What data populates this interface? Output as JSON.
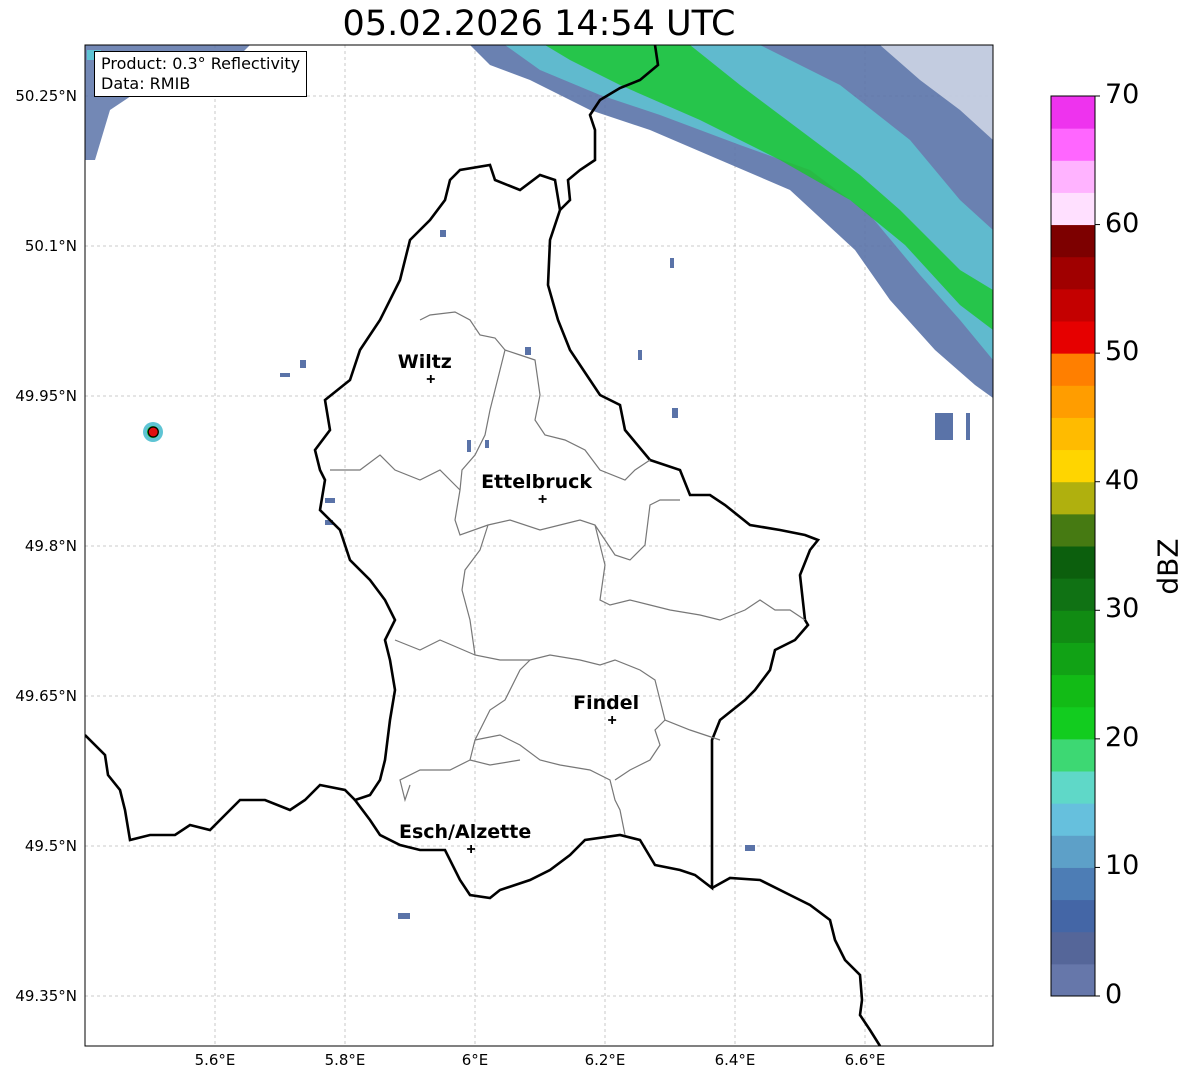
{
  "title": "05.02.2026 14:54 UTC",
  "info": {
    "product": "Product: 0.3° Reflectivity",
    "data": "Data: RMIB"
  },
  "lat_ticks": [
    "50.25°N",
    "50.1°N",
    "49.95°N",
    "49.8°N",
    "49.65°N",
    "49.5°N",
    "49.35°N"
  ],
  "lon_ticks": [
    "5.6°E",
    "5.8°E",
    "6°E",
    "6.2°E",
    "6.4°E",
    "6.6°E"
  ],
  "cities": [
    {
      "name": "Wiltz",
      "lat": 49.967,
      "lon": 5.932
    },
    {
      "name": "Ettelbruck",
      "lat": 49.847,
      "lon": 6.104
    },
    {
      "name": "Findel",
      "lat": 49.626,
      "lon": 6.211
    },
    {
      "name": "Esch/Alzette",
      "lat": 49.497,
      "lon": 5.994
    }
  ],
  "radar_site": {
    "lat": 49.914,
    "lon": 5.505
  },
  "colorbar": {
    "label": "dBZ",
    "ticks": [
      "0",
      "10",
      "20",
      "30",
      "40",
      "50",
      "60",
      "70"
    ],
    "colors": [
      "#6677aa",
      "#556699",
      "#4466a6",
      "#4d7db5",
      "#5da0c8",
      "#66c0dd",
      "#5fd8c8",
      "#3dd873",
      "#12cc1f",
      "#12bb16",
      "#11a215",
      "#118b13",
      "#107214",
      "#0c5f0d",
      "#467a12",
      "#b0b00e",
      "#ffd500",
      "#ffbb00",
      "#ff9d00",
      "#ff7f00",
      "#e60000",
      "#c40000",
      "#a00000",
      "#7d0000",
      "#ffe0ff",
      "#ffb3ff",
      "#ff66ff",
      "#ee33ee"
    ]
  }
}
